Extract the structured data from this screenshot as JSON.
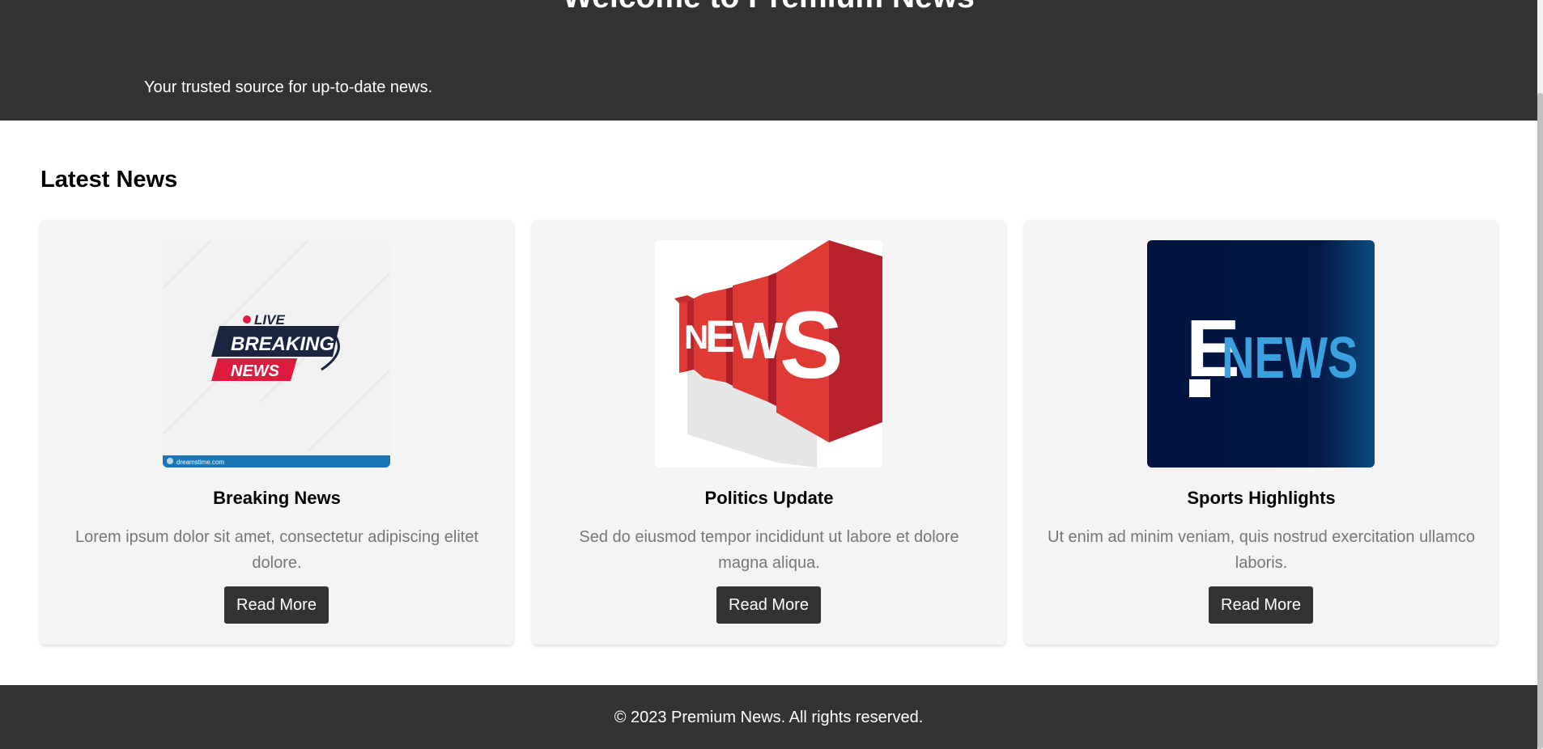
{
  "header": {
    "title": "Welcome to Premium News",
    "tagline": "Your trusted source for up-to-date news."
  },
  "main": {
    "section_title": "Latest News",
    "articles": [
      {
        "title": "Breaking News",
        "description": "Lorem ipsum dolor sit amet, consectetur adipiscing elitet dolore.",
        "button_label": "Read More",
        "image": {
          "name": "live-breaking-news-logo",
          "badge_text": "LIVE",
          "line1": "BREAKING",
          "line2": "NEWS",
          "footer_text": "dreamstime.com"
        }
      },
      {
        "title": "Politics Update",
        "description": "Sed do eiusmod tempor incididunt ut labore et dolore magna aliqua.",
        "button_label": "Read More",
        "image": {
          "name": "news-3d-blocks-logo",
          "letters": [
            "N",
            "E",
            "W",
            "S"
          ]
        }
      },
      {
        "title": "Sports Highlights",
        "description": "Ut enim ad minim veniam, quis nostrud exercitation ullamco laboris.",
        "button_label": "Read More",
        "image": {
          "name": "e-news-logo",
          "mark": "E",
          "word": "NEWS"
        }
      }
    ]
  },
  "footer": {
    "text": "© 2023 Premium News. All rights reserved."
  },
  "colors": {
    "header_bg": "#333333",
    "card_bg": "#f4f4f4",
    "button_bg": "#333333",
    "desc_text": "#777777",
    "breaking_red": "#e0193f",
    "breaking_navy": "#1b2540",
    "news_block_red": "#e03a35",
    "enews_bg": "#021340",
    "enews_blue": "#3aa0df"
  }
}
